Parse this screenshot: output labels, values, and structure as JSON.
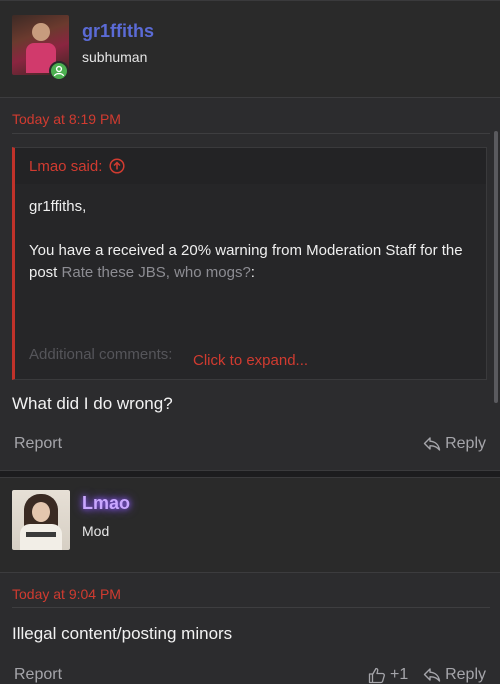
{
  "post1": {
    "username": "gr1ffiths",
    "user_title": "subhuman",
    "date": "Today at 8:19 PM",
    "quote": {
      "author_line": "Lmao said:",
      "greeting": "gr1ffiths,",
      "text_before": "You have a received a 20% warning from Moderation Staff for the post ",
      "link_text": "Rate these JBS, who mogs?",
      "text_after": ":",
      "faded_text": "Additional comments:",
      "expand_label": "Click to expand..."
    },
    "message": "What did I do wrong?",
    "report_label": "Report",
    "reply_label": "Reply"
  },
  "post2": {
    "username": "Lmao",
    "user_title": "Mod",
    "date": "Today at 9:04 PM",
    "message": "Illegal content/posting minors",
    "report_label": "Report",
    "like_count": "+1",
    "reply_label": "Reply"
  },
  "colors": {
    "accent_red": "#d13b30",
    "username_blue": "#5b6bd6",
    "mod_purple": "#c9a7ff",
    "online_green": "#4caf50"
  },
  "icons": [
    "person-icon",
    "arrow-up-circle-icon",
    "reply-icon",
    "thumbs-up-icon"
  ]
}
